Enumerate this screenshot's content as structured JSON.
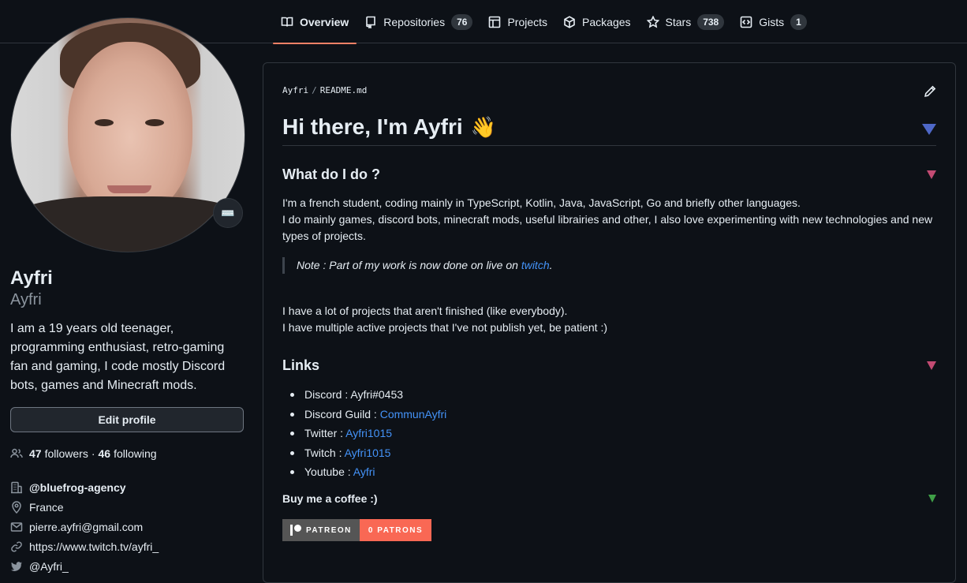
{
  "nav": {
    "tabs": [
      {
        "label": "Overview",
        "icon": "book-icon",
        "count": null
      },
      {
        "label": "Repositories",
        "icon": "repo-icon",
        "count": "76"
      },
      {
        "label": "Projects",
        "icon": "table-icon",
        "count": null
      },
      {
        "label": "Packages",
        "icon": "package-icon",
        "count": null
      },
      {
        "label": "Stars",
        "icon": "star-icon",
        "count": "738"
      },
      {
        "label": "Gists",
        "icon": "code-square-icon",
        "count": "1"
      }
    ]
  },
  "profile": {
    "status_emoji": "⌨️",
    "name": "Ayfri",
    "login": "Ayfri",
    "bio": "I am a 19 years old teenager, programming enthusiast, retro-gaming fan and gaming, I code mostly Discord bots, games and Minecraft mods.",
    "edit_label": "Edit profile",
    "followers_count": "47",
    "followers_label": "followers",
    "following_count": "46",
    "following_label": "following",
    "organization": "@bluefrog-agency",
    "location": "France",
    "email": "pierre.ayfri@gmail.com",
    "website": "https://www.twitch.tv/ayfri_",
    "twitter": "@Ayfri_"
  },
  "readme": {
    "breadcrumb_user": "Ayfri",
    "breadcrumb_file": "README.md",
    "title": "Hi there, I'm Ayfri",
    "title_emoji": "👋",
    "section1_title": "What do I do ?",
    "p1_line1": "I'm a french student, coding mainly in TypeScript, Kotlin, Java, JavaScript, Go and briefly other languages.",
    "p1_line2": "I do mainly games, discord bots, minecraft mods, useful librairies and other, I also love experimenting with new technologies and new types of projects.",
    "quote_text": "Note : Part of my work is now done on live on ",
    "quote_link": "twitch",
    "quote_end": ".",
    "p2_line1": "I have a lot of projects that aren't finished (like everybody).",
    "p2_line2": "I have multiple active projects that I've not publish yet, be patient :)",
    "links_title": "Links",
    "links": [
      {
        "label": "Discord : ",
        "value": "Ayfri#0453",
        "is_link": false
      },
      {
        "label": "Discord Guild : ",
        "value": "CommunAyfri",
        "is_link": true
      },
      {
        "label": "Twitter : ",
        "value": "Ayfri1015",
        "is_link": true
      },
      {
        "label": "Twitch : ",
        "value": "Ayfri1015",
        "is_link": true
      },
      {
        "label": "Youtube : ",
        "value": "Ayfri",
        "is_link": true
      }
    ],
    "coffee_title": "Buy me a coffee :)",
    "patreon_label": "PATREON",
    "patreon_count": "0 PATRONS"
  },
  "colors": {
    "accent_underline": "#f78166",
    "link": "#4493f8",
    "patreon": "#f96854"
  }
}
